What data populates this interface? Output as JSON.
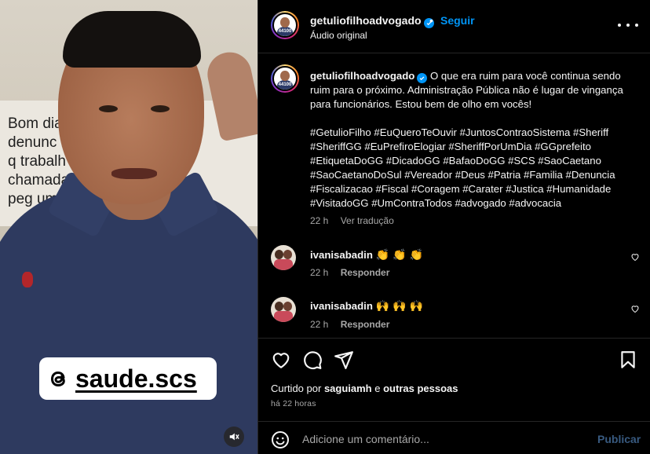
{
  "video": {
    "background_text": "Bom dia\ndenunc          na UBS\nq trabalh        neira\nchamada         e em\npeg                uma",
    "overlay_handle": "saude.scs",
    "avatar_badge": "44100"
  },
  "header": {
    "username": "getuliofilhoadvogado",
    "separator": "•",
    "follow_label": "Seguir",
    "audio_label": "Áudio original"
  },
  "caption": {
    "username": "getuliofilhoadvogado",
    "text": "O que era ruim para você continua sendo ruim para o próximo. Administração Pública não é lugar de vingança para funcionários. Estou bem de olho em vocês!",
    "hashtags": "#GetulioFilho #EuQueroTeOuvir #JuntosContraoSistema #Sheriff #SheriffGG #EuPrefiroElogiar #SheriffPorUmDia #GGprefeito #EtiquetaDoGG #DicadoGG #BafaoDoGG #SCS #SaoCaetano #SaoCaetanoDoSul #Vereador #Deus #Patria #Familia #Denuncia #Fiscalizacao #Fiscal #Coragem #Carater #Justica #Humanidade #VisitadoGG #UmContraTodos #advogado #advocacia",
    "time": "22 h",
    "translate_label": "Ver tradução"
  },
  "comments": [
    {
      "username": "ivanisabadin",
      "text": "👏 👏 👏",
      "time": "22 h",
      "reply_label": "Responder"
    },
    {
      "username": "ivanisabadin",
      "text": "🙌 🙌 🙌",
      "time": "22 h",
      "reply_label": "Responder"
    }
  ],
  "actions": {
    "liked_prefix": "Curtido por",
    "liked_user": "saguiamh",
    "liked_and": "e",
    "liked_others": "outras pessoas",
    "time_ago": "há 22 horas"
  },
  "comment_bar": {
    "placeholder": "Adicione um comentário...",
    "publish_label": "Publicar"
  },
  "colors": {
    "accent": "#0095f6",
    "background": "#000000",
    "muted_text": "#a8a8a8",
    "publish_disabled": "#385a80"
  }
}
